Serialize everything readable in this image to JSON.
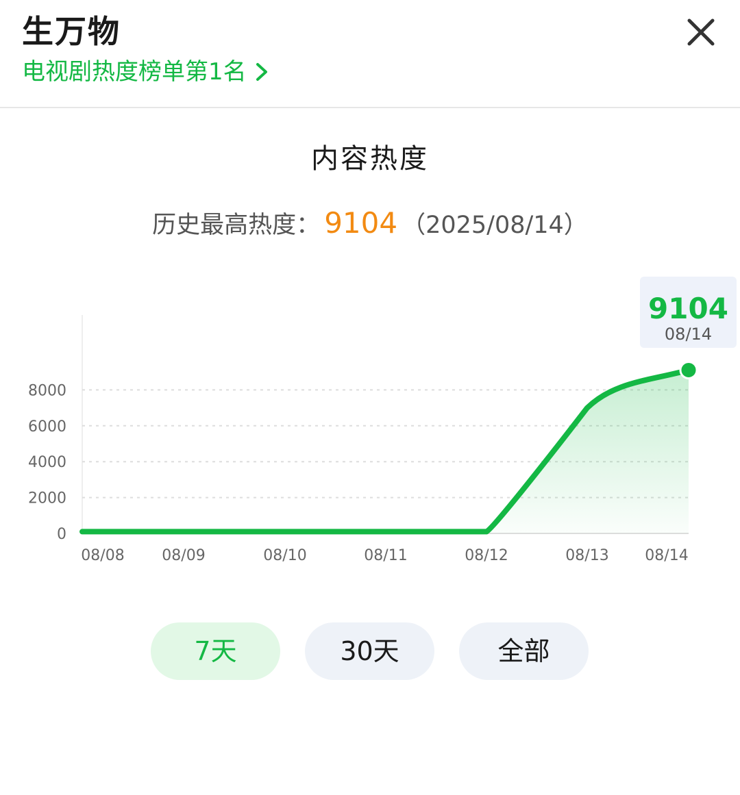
{
  "header": {
    "title": "生万物",
    "rank_link": "电视剧热度榜单第1名"
  },
  "section_title": "内容热度",
  "peak": {
    "label": "历史最高热度：",
    "value": "9104",
    "date": "（2025/08/14）"
  },
  "tooltip": {
    "value": "9104",
    "date": "08/14"
  },
  "range_buttons": [
    {
      "label": "7天",
      "active": true
    },
    {
      "label": "30天",
      "active": false
    },
    {
      "label": "全部",
      "active": false
    }
  ],
  "colors": {
    "accent": "#14b844",
    "peak_value": "#f28a12",
    "button_bg": "#eef2f8",
    "button_active_bg": "#e2f8e6"
  },
  "icons": {
    "close": "close-icon",
    "chevron": "chevron-right-icon"
  },
  "chart_data": {
    "type": "area",
    "title": "",
    "xlabel": "",
    "ylabel": "",
    "x": [
      "08/08",
      "08/09",
      "08/10",
      "08/11",
      "08/12",
      "08/13",
      "08/14"
    ],
    "y_ticks": [
      0,
      2000,
      4000,
      6000,
      8000
    ],
    "ylim": [
      0,
      10000
    ],
    "grid": true,
    "series": [
      {
        "values": [
          100,
          100,
          100,
          100,
          100,
          7000,
          9104
        ]
      }
    ],
    "highlight": {
      "x": "08/14",
      "value": 9104
    }
  }
}
